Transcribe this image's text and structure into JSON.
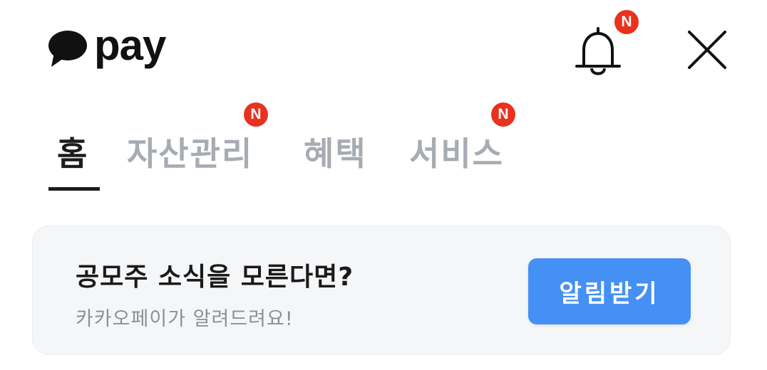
{
  "header": {
    "logo_text": "pay",
    "logo_icon": "speech-bubble-icon",
    "notification_icon": "bell-icon",
    "notification_badge": "N",
    "close_icon": "close-icon"
  },
  "tabs": [
    {
      "label": "홈",
      "active": true,
      "badge": null
    },
    {
      "label": "자산관리",
      "active": false,
      "badge": "N"
    },
    {
      "label": "혜택",
      "active": false,
      "badge": null
    },
    {
      "label": "서비스",
      "active": false,
      "badge": "N"
    }
  ],
  "promo": {
    "title": "공모주 소식을 모른다면?",
    "subtitle": "카카오페이가 알려드려요!",
    "button_label": "알림받기"
  },
  "colors": {
    "badge": "#e8321f",
    "button": "#4590f5",
    "inactive_tab": "#a7acb3",
    "active_tab": "#1c1c1c",
    "card_bg": "#f5f6f8"
  }
}
